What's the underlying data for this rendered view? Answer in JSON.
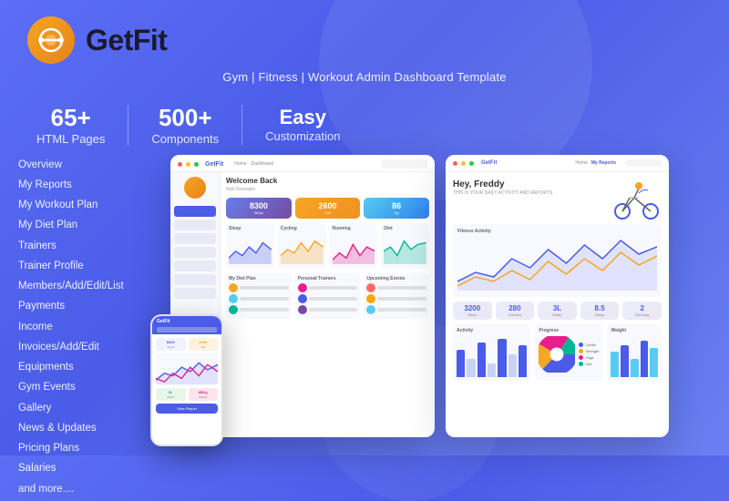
{
  "brand": {
    "name": "GetFit",
    "tagline": "Gym | Fitness | Workout Admin Dashboard Template"
  },
  "stats": {
    "pages": {
      "number": "65+",
      "label": "HTML Pages"
    },
    "components": {
      "number": "500+",
      "label": "Components"
    },
    "easy": {
      "title": "Easy",
      "subtitle": "Customization"
    }
  },
  "nav": {
    "items": [
      "Overview",
      "My Reports",
      "My Workout Plan",
      "My Diet Plan",
      "Trainers",
      "Trainer Profile",
      "Members/Add/Edit/List",
      "Payments",
      "Income",
      "Invoices/Add/Edit",
      "Equipments",
      "Gym Events",
      "Gallery",
      "News & Updates",
      "Pricing Plans",
      "Salaries",
      "and more...."
    ]
  },
  "mockup": {
    "welcome": "Welcome Back",
    "user": "Nick Gonzalez",
    "greeting": "Hey, Freddy",
    "date": "THIS IS YOUR DAILY ACTIVITY AND REPORTS"
  },
  "quick_stats": [
    {
      "num": "3200",
      "lbl": "Steps"
    },
    {
      "num": "280",
      "lbl": "Calories"
    },
    {
      "num": "3L",
      "lbl": "Water"
    },
    {
      "num": "8.5",
      "lbl": "Sleep"
    },
    {
      "num": "2",
      "lbl": "Running"
    }
  ],
  "charts": {
    "sleep": "Sleep",
    "cycling": "Cycling",
    "running": "Running",
    "diet": "Diet"
  },
  "bottom": {
    "diet_plan": "My Diet Plan",
    "trainers": "Personal Trainers",
    "events": "Upcoming Events",
    "activity": "Activity",
    "progress": "Progress",
    "weight": "Weight"
  },
  "colors": {
    "primary": "#4a5ce8",
    "orange": "#f5a623",
    "green": "#56ccf2",
    "purple": "#764ba2",
    "pink": "#e91e8c",
    "teal": "#00b894",
    "bg": "#5b6ef5"
  }
}
